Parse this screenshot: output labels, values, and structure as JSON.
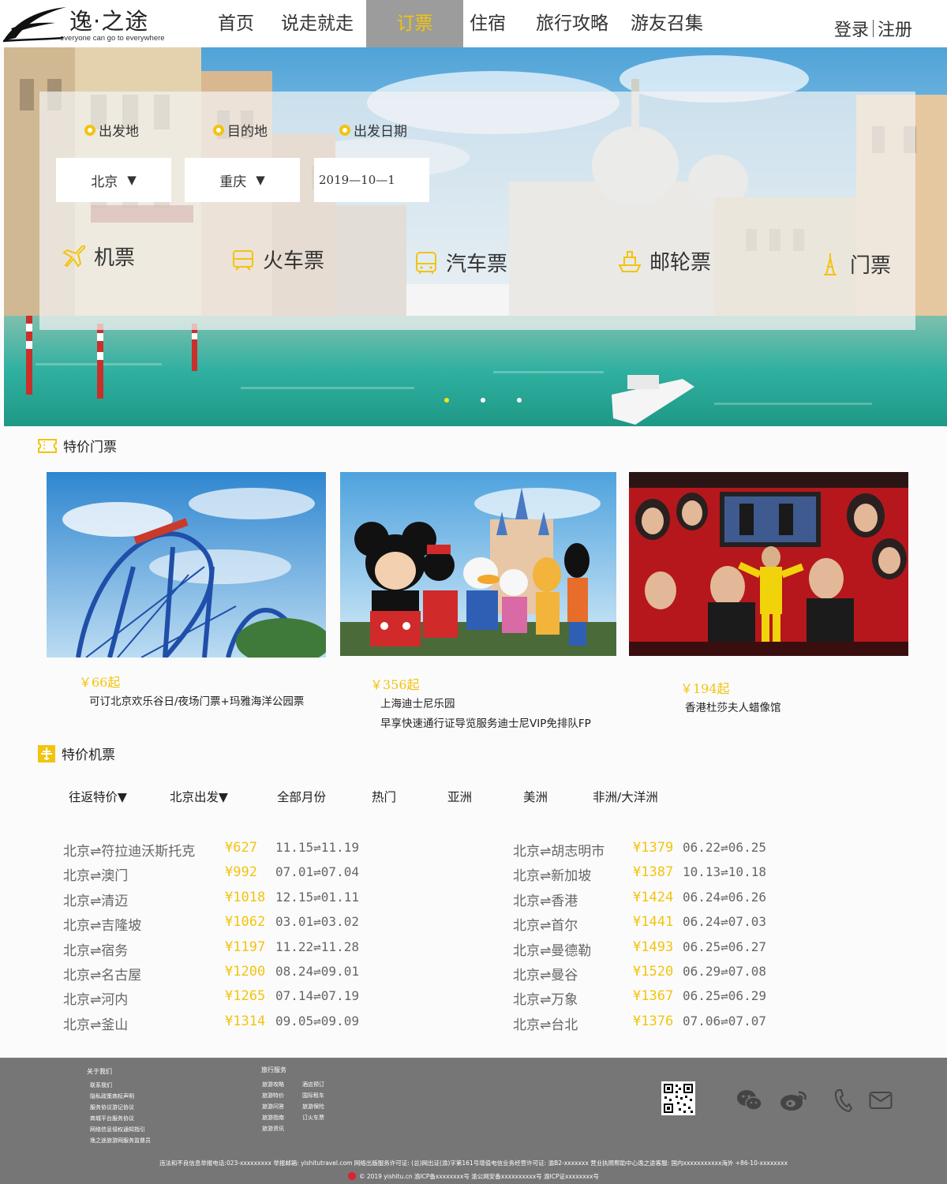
{
  "brand": {
    "name": "逸·之途",
    "slogan": "everyone can go to everywhere"
  },
  "nav": {
    "items": [
      "首页",
      "说走就走",
      "订票",
      "住宿",
      "旅行攻略",
      "游友召集"
    ],
    "active_index": 2
  },
  "auth": {
    "login": "登录",
    "register": "注册"
  },
  "search": {
    "labels": {
      "from": "出发地",
      "to": "目的地",
      "date": "出发日期"
    },
    "from_value": "北京",
    "to_value": "重庆",
    "date_value": "2019—10—1",
    "caret": "▼"
  },
  "ticket_types": [
    "机票",
    "火车票",
    "汽车票",
    "邮轮票",
    "门票"
  ],
  "carousel": {
    "count": 3,
    "active": 0
  },
  "deals": {
    "title": "特价门票",
    "items": [
      {
        "price": "￥66起",
        "desc": [
          "可订北京欢乐谷日/夜场门票+玛雅海洋公园票"
        ]
      },
      {
        "price": "￥356起",
        "desc": [
          "上海迪士尼乐园",
          "早享快速通行证导览服务迪士尼VIP免排队FP"
        ]
      },
      {
        "price": "￥194起",
        "desc": [
          "香港杜莎夫人蜡像馆"
        ]
      }
    ]
  },
  "flights": {
    "title": "特价机票",
    "filters": [
      "往返特价▼",
      "北京出发▼",
      "全部月份",
      "热门",
      "亚洲",
      "美洲",
      "非洲/大洋洲"
    ],
    "left": [
      {
        "route": "北京⇌符拉迪沃斯托克",
        "price": "¥627",
        "dates": "11.15⇌11.19"
      },
      {
        "route": "北京⇌澳门",
        "price": "¥992",
        "dates": "07.01⇌07.04"
      },
      {
        "route": "北京⇌清迈",
        "price": "¥1018",
        "dates": "12.15⇌01.11"
      },
      {
        "route": "北京⇌吉隆坡",
        "price": "¥1062",
        "dates": "03.01⇌03.02"
      },
      {
        "route": "北京⇌宿务",
        "price": "¥1197",
        "dates": "11.22⇌11.28"
      },
      {
        "route": "北京⇌名古屋",
        "price": "¥1200",
        "dates": "08.24⇌09.01"
      },
      {
        "route": "北京⇌河内",
        "price": "¥1265",
        "dates": "07.14⇌07.19"
      },
      {
        "route": "北京⇌釜山",
        "price": "¥1314",
        "dates": "09.05⇌09.09"
      }
    ],
    "right": [
      {
        "route": "北京⇌胡志明市",
        "price": "¥1379",
        "dates": "06.22⇌06.25"
      },
      {
        "route": "北京⇌新加坡",
        "price": "¥1387",
        "dates": "10.13⇌10.18"
      },
      {
        "route": "北京⇌香港",
        "price": "¥1424",
        "dates": "06.24⇌06.26"
      },
      {
        "route": "北京⇌首尔",
        "price": "¥1441",
        "dates": "06.24⇌07.03"
      },
      {
        "route": "北京⇌曼德勒",
        "price": "¥1493",
        "dates": "06.25⇌06.27"
      },
      {
        "route": "北京⇌曼谷",
        "price": "¥1520",
        "dates": "06.29⇌07.08"
      },
      {
        "route": "北京⇌万象",
        "price": "¥1367",
        "dates": "06.25⇌06.29"
      },
      {
        "route": "北京⇌台北",
        "price": "¥1376",
        "dates": "07.06⇌07.07"
      }
    ]
  },
  "footer": {
    "about": {
      "title": "关于我们",
      "links": [
        "联系我们",
        "隐私政策商标声明",
        "服务协议游记协议",
        "商城平台服务协议",
        "网络信息侵权通知指引",
        "逸之途旅游网服务监督员"
      ]
    },
    "services": {
      "title": "旅行服务",
      "col1": [
        "旅游攻略",
        "旅游特价",
        "旅游问答",
        "旅游指南",
        "旅游资讯"
      ],
      "col2": [
        "酒店预订",
        "国际租车",
        "旅游保险",
        "订火车票"
      ]
    },
    "icons": [
      "qrcode-icon",
      "wechat-icon",
      "weibo-icon",
      "phone-icon",
      "mail-icon"
    ],
    "line1": "违法和不良信息举报电话:023-xxxxxxxxx 举报邮箱: yishitutravel.com 网络出版服务许可证: (总)网出证(渝)字第161号增值电信业务经营许可证: 渝B2-xxxxxxx 营业执照帮助中心逸之途客服: 国内xxxxxxxxxxx海外 +86-10-xxxxxxxx",
    "line2": "© 2019 yishitu.cn 渝ICP备xxxxxxxx号  渝公网安备xxxxxxxxxx号 渝ICP证xxxxxxxx号"
  },
  "colors": {
    "accent": "#f1c40f",
    "nav_active_bg": "#9c9c9c",
    "footer_bg": "#767676"
  }
}
